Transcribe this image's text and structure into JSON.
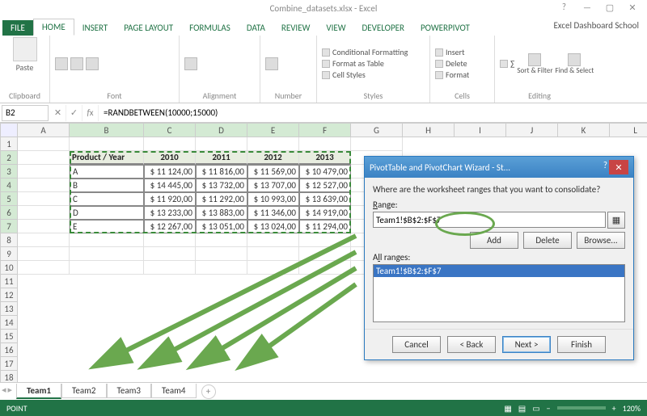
{
  "window": {
    "title": "Combine_datasets.xlsx - Excel",
    "school": "Excel Dashboard School"
  },
  "tabs": {
    "file": "FILE",
    "home": "HOME",
    "insert": "INSERT",
    "pagelayout": "PAGE LAYOUT",
    "formulas": "FORMULAS",
    "data": "DATA",
    "review": "REVIEW",
    "view": "VIEW",
    "developer": "DEVELOPER",
    "powerpivot": "POWERPIVOT"
  },
  "ribbon": {
    "paste": "Paste",
    "clipboard": "Clipboard",
    "font": "Font",
    "alignment": "Alignment",
    "number": "Number",
    "styles": "Styles",
    "cells": "Cells",
    "editing": "Editing",
    "cond": "Conditional Formatting",
    "fmt_table": "Format as Table",
    "cell_styles": "Cell Styles",
    "insert_btn": "Insert",
    "delete_btn": "Delete",
    "format_btn": "Format",
    "sort": "Sort & Filter",
    "find": "Find & Select"
  },
  "fbar": {
    "namebox": "B2",
    "formula": "=RANDBETWEEN(10000;15000)"
  },
  "cols": [
    "A",
    "B",
    "C",
    "D",
    "E",
    "F",
    "G",
    "H",
    "I",
    "J",
    "K",
    "L"
  ],
  "rows": [
    "1",
    "2",
    "3",
    "4",
    "5",
    "6",
    "7",
    "8",
    "9",
    "10",
    "11",
    "12",
    "13",
    "14",
    "15",
    "16",
    "17",
    "18"
  ],
  "table": {
    "header": [
      "Product  / Year",
      "2010",
      "2011",
      "2012",
      "2013"
    ],
    "data": [
      [
        "A",
        "$  11 124,00",
        "$  11 816,00",
        "$  11 569,00",
        "$  10 479,00"
      ],
      [
        "B",
        "$  14 445,00",
        "$  13 732,00",
        "$  13 707,00",
        "$  12 527,00"
      ],
      [
        "C",
        "$  11 920,00",
        "$  11 292,00",
        "$  10 993,00",
        "$  13 639,00"
      ],
      [
        "D",
        "$  13 233,00",
        "$  13 883,00",
        "$  11 346,00",
        "$  14 919,00"
      ],
      [
        "E",
        "$  12 267,00",
        "$  13 051,00",
        "$  13 024,00",
        "$  11 294,00"
      ]
    ]
  },
  "sheets": {
    "tabs": [
      "Team1",
      "Team2",
      "Team3",
      "Team4"
    ],
    "active": "Team1"
  },
  "status": {
    "mode": "POINT",
    "zoom": "120%"
  },
  "wizard": {
    "title": "PivotTable and PivotChart Wizard - St...",
    "question": "Where are the worksheet ranges that you want to consolidate?",
    "range_label": "Range:",
    "range_value": "Team1!$B$2:$F$7",
    "add": "Add",
    "delete": "Delete",
    "browse": "Browse...",
    "all_label": "All ranges:",
    "all_item": "Team1!$B$2:$F$7",
    "cancel": "Cancel",
    "back": "< Back",
    "next": "Next >",
    "finish": "Finish"
  },
  "chart_data": {
    "type": "table",
    "title": "Product / Year",
    "columns": [
      "Product",
      "2010",
      "2011",
      "2012",
      "2013"
    ],
    "rows": [
      {
        "Product": "A",
        "2010": 11124,
        "2011": 11816,
        "2012": 11569,
        "2013": 10479
      },
      {
        "Product": "B",
        "2010": 14445,
        "2011": 13732,
        "2012": 13707,
        "2013": 12527
      },
      {
        "Product": "C",
        "2010": 11920,
        "2011": 11292,
        "2012": 10993,
        "2013": 13639
      },
      {
        "Product": "D",
        "2010": 13233,
        "2011": 13883,
        "2012": 11346,
        "2013": 14919
      },
      {
        "Product": "E",
        "2010": 12267,
        "2011": 13051,
        "2012": 13024,
        "2013": 11294
      }
    ]
  }
}
